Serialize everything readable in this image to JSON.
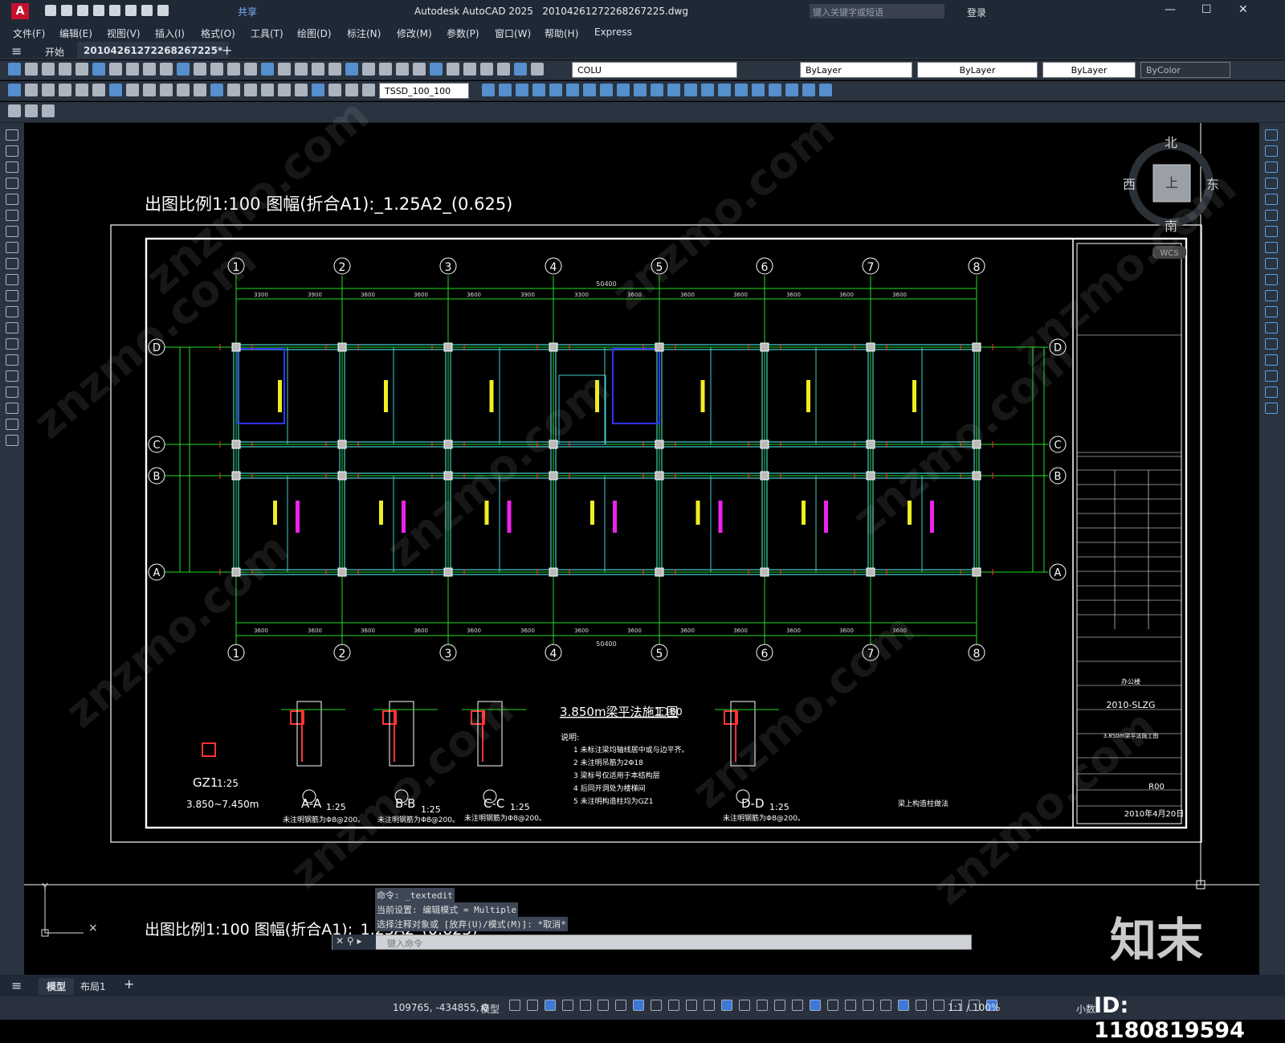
{
  "app": {
    "logo": "A",
    "share": "共享",
    "title": "Autodesk AutoCAD 2025",
    "file": "20104261272268267225.dwg",
    "search_placeholder": "键入关键字或短语",
    "login": "登录"
  },
  "menu": [
    "文件(F)",
    "编辑(E)",
    "视图(V)",
    "插入(I)",
    "格式(O)",
    "工具(T)",
    "绘图(D)",
    "标注(N)",
    "修改(M)",
    "参数(P)",
    "窗口(W)",
    "帮助(H)",
    "Express"
  ],
  "tabs": {
    "start": "开始",
    "doc": "20104261272268267225*"
  },
  "toolbar": {
    "layer": "COLU",
    "color": "ByLayer",
    "linetype": "ByLayer",
    "lineweight": "ByLayer",
    "plotstyle": "ByColor",
    "dimstyle": "TSSD_100_100"
  },
  "drawing": {
    "scale_top": "出图比例1:100 图幅(折合A1):_1.25A2_(0.625)",
    "scale_bottom": "出图比例1:100 图幅(折合A1):_1.25A2_(0.625)",
    "axes_num": [
      "1",
      "2",
      "3",
      "4",
      "5",
      "6",
      "7",
      "8"
    ],
    "axes_letter": [
      "D",
      "C",
      "B",
      "A"
    ],
    "top_dims": [
      "3300",
      "3900",
      "3600",
      "3600",
      "3600",
      "3900",
      "3300",
      "3600",
      "3600",
      "3600",
      "3600",
      "3600",
      "3600"
    ],
    "total_dim": "50400",
    "bottom_dims": [
      "3600",
      "3600",
      "3600",
      "3600",
      "3600",
      "3600",
      "3600",
      "3600",
      "3600",
      "3600",
      "3600",
      "3600",
      "3600",
      "3600"
    ],
    "left_dims": [
      "6600",
      "2100",
      "6600",
      "15300"
    ],
    "plan_title": "3.850m梁平法施工图",
    "plan_scale": "1:100",
    "notes_title": "说明:",
    "notes": [
      "1 未标注梁均轴线居中或与边平齐。",
      "2 未注明吊筋为2Φ18",
      "3 梁标号仅适用于本结构层",
      "4 后同开洞处为楼梯间",
      "5 未注明构造柱均为GZ1"
    ],
    "sections": [
      {
        "mark": "GZ1",
        "scale": "1:25",
        "note": "3.850~7.450m"
      },
      {
        "mark": "A-A",
        "scale": "1:25",
        "note": "未注明钢筋为Φ8@200。"
      },
      {
        "mark": "B-B",
        "scale": "1:25",
        "note": "未注明钢筋为Φ8@200。"
      },
      {
        "mark": "C-C",
        "scale": "1:25",
        "note": "未注明钢筋为Φ8@200。"
      },
      {
        "mark": "D-D",
        "scale": "1:25",
        "note": "未注明钢筋为Φ8@200。"
      }
    ],
    "detail_title": "梁上构造柱做法",
    "title_block": {
      "project": "办公楼",
      "code": "2010-SLZG",
      "drawing": "3.850m梁平法施工图",
      "rev": "R00",
      "date": "2010年4月20日"
    },
    "compass": {
      "n": "北",
      "s": "南",
      "w": "西",
      "e": "东",
      "top": "上",
      "wcs": "WCS"
    }
  },
  "cmd": [
    "命令: _textedit",
    "当前设置: 编辑模式 = Multiple",
    "选择注释对象或 [放弃(U)/模式(M)]: *取消*"
  ],
  "cmd_placeholder": "键入命令",
  "layouts": [
    "模型",
    "布局1"
  ],
  "status": {
    "coords": "109765, -434855, 0",
    "model": "模型",
    "scale": "1:1 / 100%",
    "units": "小数"
  },
  "overlay": {
    "brand": "知末",
    "id": "ID: 1180819594"
  }
}
